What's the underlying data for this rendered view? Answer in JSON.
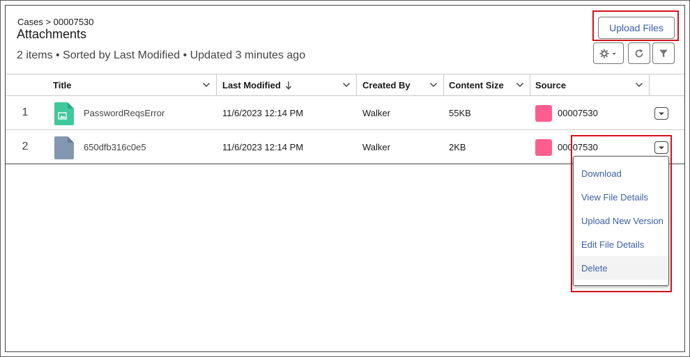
{
  "header": {
    "breadcrumb": "Cases > 00007530",
    "title": "Attachments",
    "subtitle": "2 items • Sorted by Last Modified • Updated 3 minutes ago",
    "upload_label": "Upload Files"
  },
  "toolbar": {
    "icons": [
      "gear-icon",
      "refresh-icon",
      "filter-icon"
    ]
  },
  "columns": [
    {
      "label": "Title"
    },
    {
      "label": "Last Modified",
      "sort": "descending"
    },
    {
      "label": "Created By"
    },
    {
      "label": "Content Size"
    },
    {
      "label": "Source"
    }
  ],
  "rows": [
    {
      "num": "1",
      "title": "PasswordReqsError",
      "modified": "11/6/2023 12:14 PM",
      "created_by": "Walker",
      "size": "55KB",
      "source": "00007530",
      "icon": "image-file-icon"
    },
    {
      "num": "2",
      "title": "650dfb316c0e5",
      "modified": "11/6/2023 12:14 PM",
      "created_by": "Walker",
      "size": "2KB",
      "source": "00007530",
      "icon": "generic-file-icon"
    }
  ],
  "menu": {
    "items": [
      "Download",
      "View File Details",
      "Upload New Version",
      "Edit File Details",
      "Delete"
    ]
  },
  "colors": {
    "accent": "#3a5fa8",
    "highlight": "#d4111a",
    "image_file": "#3fc99a",
    "generic_file": "#8497b0",
    "source_swatch": "#ff5d8f"
  }
}
